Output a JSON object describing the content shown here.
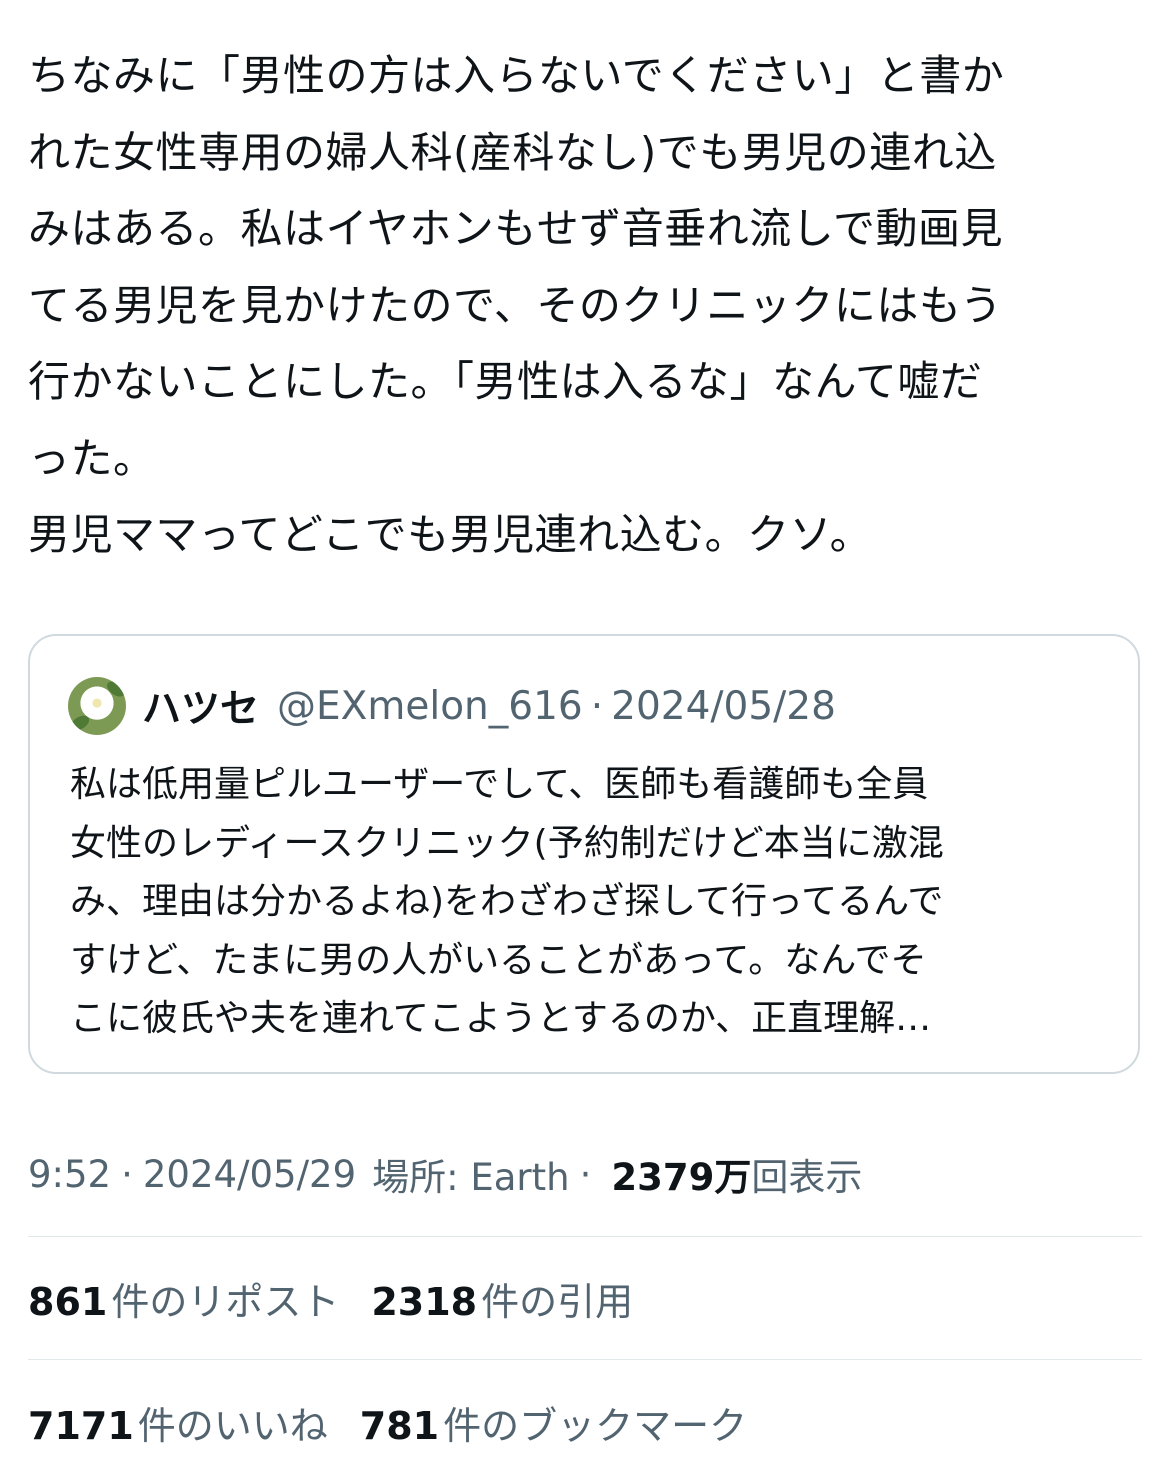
{
  "tweet": {
    "text_lines": [
      "ちなみに「男性の方は入らないでください」と書か",
      "れた女性専用の婦人科(産科なし)でも男児の連れ込",
      "みはある。私はイヤホンもせず音垂れ流しで動画見",
      "てる男児を見かけたので、そのクリニックにはもう",
      "行かないことにした。「男性は入るな」なんて嘘だ",
      "った。",
      "男児ママってどこでも男児連れ込む。クソ。"
    ]
  },
  "quote": {
    "avatar_icon": "white-flower-avatar",
    "name": "ハツセ",
    "handle": "@EXmelon_616",
    "separator": "·",
    "date": "2024/05/28",
    "body_lines": [
      "私は低用量ピルユーザーでして、医師も看護師も全員",
      "女性のレディースクリニック(予約制だけど本当に激混",
      "み、理由は分かるよね)をわざわざ探して行ってるんで",
      "すけど、たまに男の人がいることがあって。なんでそ",
      "こに彼氏や夫を連れてこようとするのか、正直理解…"
    ]
  },
  "meta": {
    "time": "9:52",
    "separator": "·",
    "date": "2024/05/29",
    "location": "場所: Earth",
    "views_count": "2379万",
    "views_label": "回表示"
  },
  "stats": {
    "reposts_count": "861",
    "reposts_label": "件のリポスト",
    "quotes_count": "2318",
    "quotes_label": "件の引用",
    "likes_count": "7171",
    "likes_label": "件のいいね",
    "bookmarks_count": "781",
    "bookmarks_label": "件のブックマーク"
  },
  "colors": {
    "text_primary": "#0f1419",
    "text_secondary": "#536471",
    "border": "#cfd9de",
    "divider": "#e3e8eb"
  }
}
